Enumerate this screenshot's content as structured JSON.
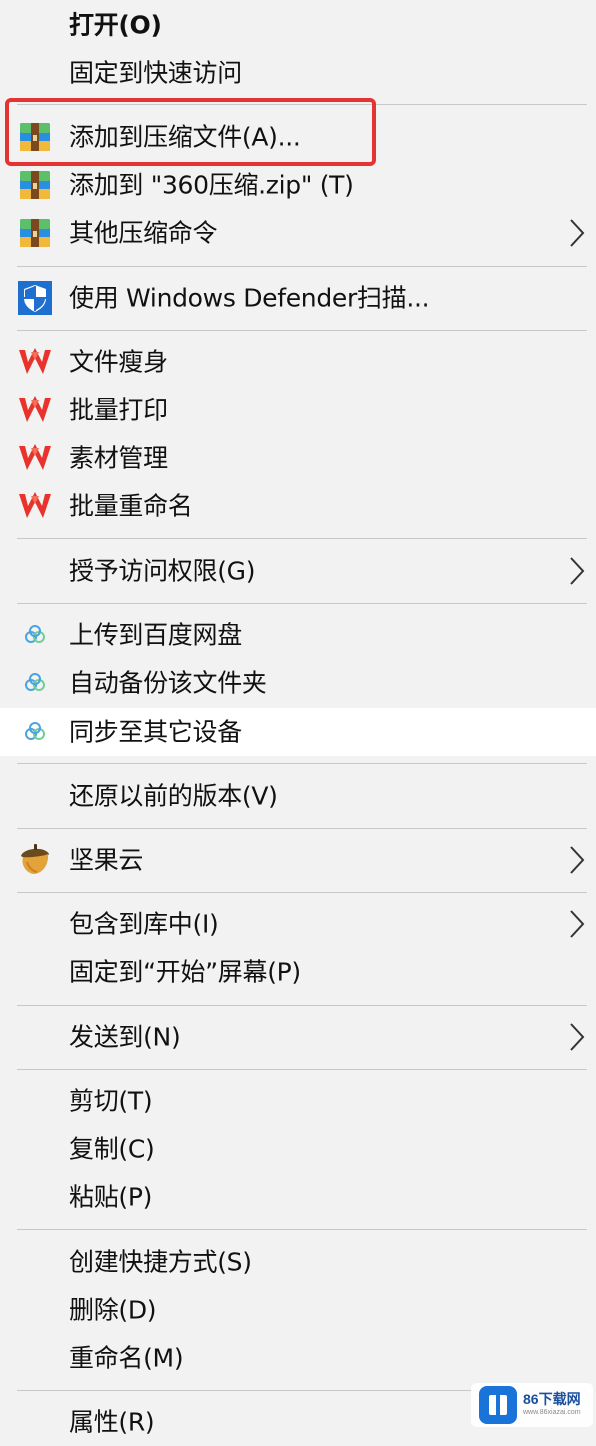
{
  "menu": {
    "items": [
      {
        "label": "打开(O)",
        "icon": null
      },
      {
        "label": "固定到快速访问",
        "icon": null
      },
      {
        "label": "添加到压缩文件(A)...",
        "icon": "360zip-icon"
      },
      {
        "label": "添加到 \"360压缩.zip\" (T)",
        "icon": "360zip-icon"
      },
      {
        "label": "其他压缩命令",
        "icon": "360zip-icon",
        "submenu": true
      },
      {
        "label": "使用 Windows Defender扫描...",
        "icon": "windows-defender-shield-icon"
      },
      {
        "label": "文件瘦身",
        "icon": "wps-icon"
      },
      {
        "label": "批量打印",
        "icon": "wps-icon"
      },
      {
        "label": "素材管理",
        "icon": "wps-icon"
      },
      {
        "label": "批量重命名",
        "icon": "wps-icon"
      },
      {
        "label": "授予访问权限(G)",
        "icon": null,
        "submenu": true
      },
      {
        "label": "上传到百度网盘",
        "icon": "baidu-netdisk-icon"
      },
      {
        "label": "自动备份该文件夹",
        "icon": "baidu-netdisk-icon"
      },
      {
        "label": "同步至其它设备",
        "icon": "baidu-netdisk-icon",
        "hovered": true
      },
      {
        "label": "还原以前的版本(V)",
        "icon": null
      },
      {
        "label": "坚果云",
        "icon": "jianguoyun-acorn-icon",
        "submenu": true
      },
      {
        "label": "包含到库中(I)",
        "icon": null,
        "submenu": true
      },
      {
        "label": "固定到“开始”屏幕(P)",
        "icon": null
      },
      {
        "label": "发送到(N)",
        "icon": null,
        "submenu": true
      },
      {
        "label": "剪切(T)",
        "icon": null
      },
      {
        "label": "复制(C)",
        "icon": null
      },
      {
        "label": "粘贴(P)",
        "icon": null
      },
      {
        "label": "创建快捷方式(S)",
        "icon": null
      },
      {
        "label": "删除(D)",
        "icon": null
      },
      {
        "label": "重命名(M)",
        "icon": null
      },
      {
        "label": "属性(R)",
        "icon": null
      }
    ]
  },
  "annotation": {
    "color": "#e53333"
  },
  "watermark": {
    "brand": "86下载网",
    "sub": "www.86xiazai.com"
  },
  "colors": {
    "menu_bg": "#f2f2f2",
    "hover_bg": "#ffffff",
    "separator": "#c8c8c8",
    "wps_red": "#e8322c",
    "defender_blue": "#1f6fd1",
    "baidu_blue": "#4aa3df"
  }
}
